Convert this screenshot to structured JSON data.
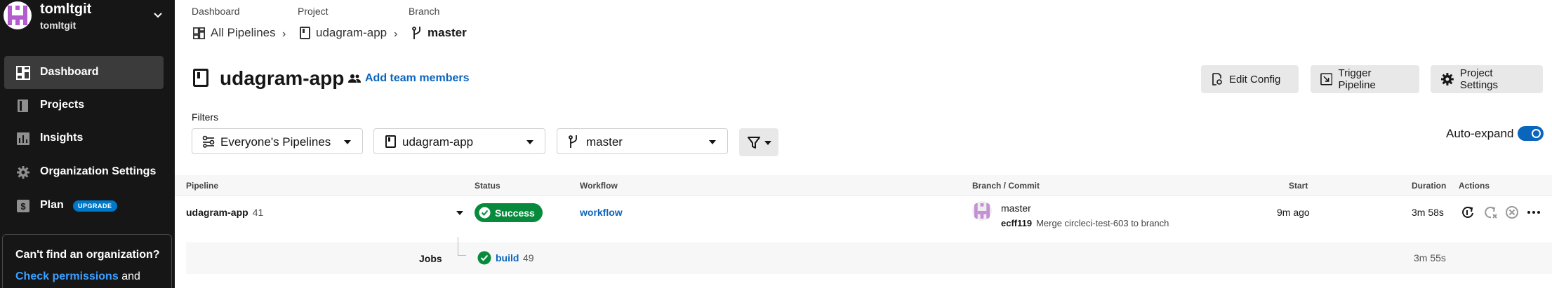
{
  "org": {
    "name": "tomltgit",
    "handle": "tomltgit"
  },
  "sidebar": {
    "items": [
      {
        "label": "Dashboard",
        "icon": "dashboard-icon",
        "active": true
      },
      {
        "label": "Projects",
        "icon": "projects-icon"
      },
      {
        "label": "Insights",
        "icon": "insights-icon"
      },
      {
        "label": "Organization Settings",
        "icon": "gear-icon"
      },
      {
        "label": "Plan",
        "icon": "dollar-icon",
        "badge": "UPGRADE"
      }
    ],
    "help": {
      "title": "Can't find an organization?",
      "link": "Check permissions",
      "suffix": "and"
    }
  },
  "breadcrumbs": {
    "labels": [
      "Dashboard",
      "Project",
      "Branch"
    ],
    "items": [
      "All Pipelines",
      "udagram-app",
      "master"
    ]
  },
  "header": {
    "title": "udagram-app",
    "add_team": "Add team members",
    "buttons": [
      "Edit Config",
      "Trigger Pipeline",
      "Project Settings"
    ]
  },
  "filters": {
    "label": "Filters",
    "pipelines": "Everyone's Pipelines",
    "project": "udagram-app",
    "branch": "master",
    "autoexpand": "Auto-expand",
    "autoexpand_on": true
  },
  "table": {
    "headers": [
      "Pipeline",
      "Status",
      "Workflow",
      "Branch / Commit",
      "Start",
      "Duration",
      "Actions"
    ],
    "row": {
      "pipeline": "udagram-app",
      "number": "41",
      "status": "Success",
      "workflow": "workflow",
      "branch": "master",
      "sha": "ecff119",
      "message": "Merge circleci-test-603 to branch",
      "start": "9m ago",
      "duration": "3m 58s"
    },
    "jobs": {
      "label": "Jobs",
      "name": "build",
      "number": "49",
      "duration": "3m 55s"
    }
  },
  "colors": {
    "success": "#088a3c",
    "link": "#0a65bd",
    "sidebar_bg": "#161616"
  }
}
